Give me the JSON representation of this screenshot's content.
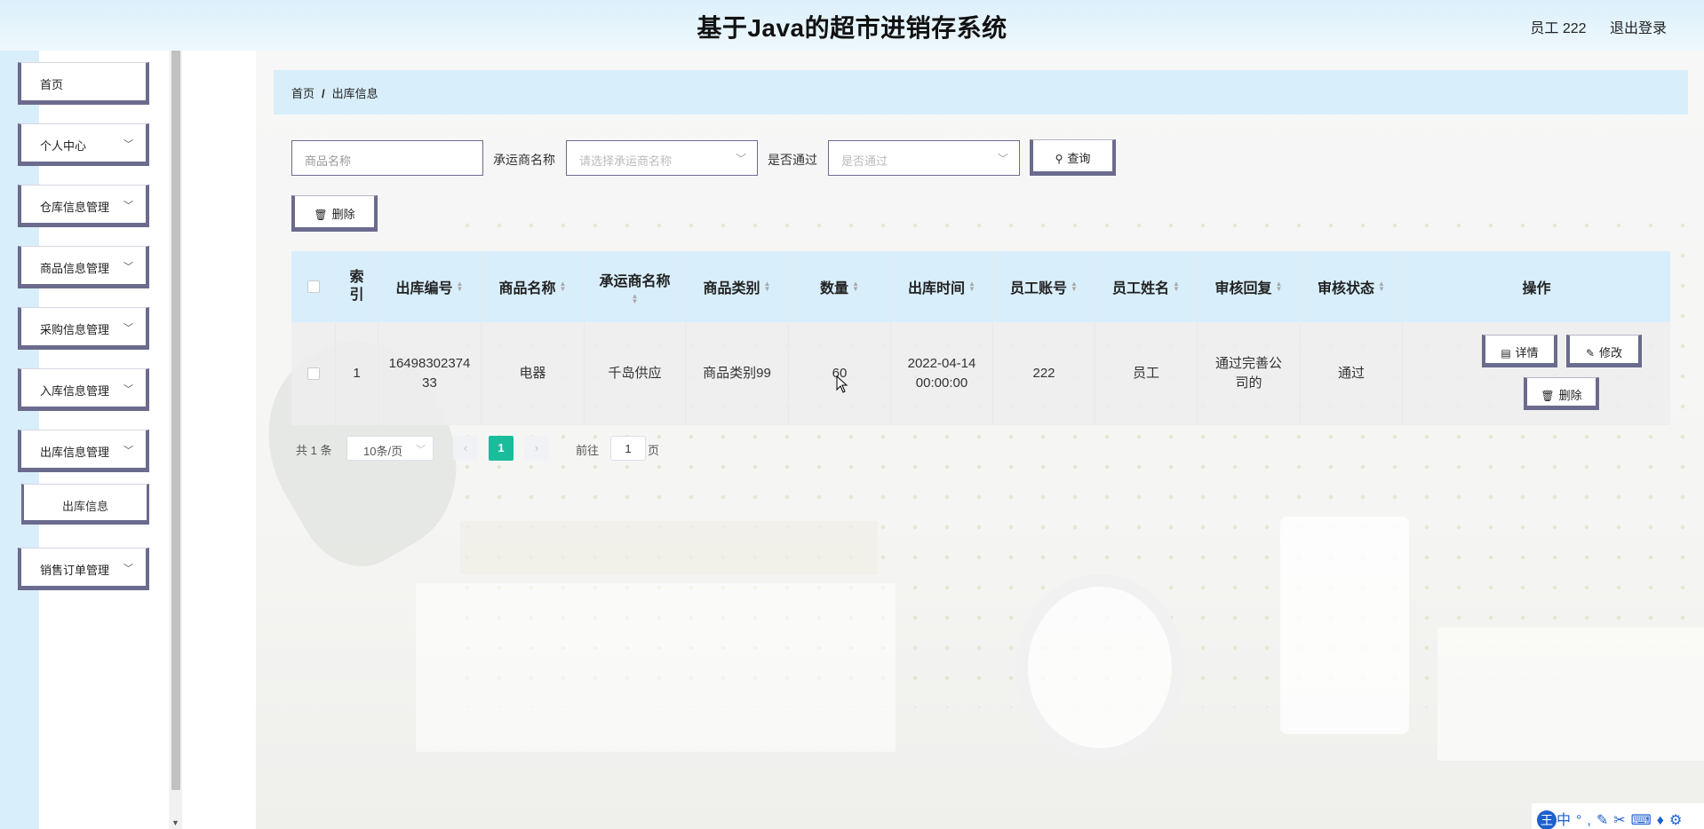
{
  "header": {
    "title": "基于Java的超市进销存系统",
    "user": "员工 222",
    "logout": "退出登录"
  },
  "sidebar": {
    "items": [
      {
        "label": "首页",
        "has_children": false
      },
      {
        "label": "个人中心",
        "has_children": true
      },
      {
        "label": "仓库信息管理",
        "has_children": true
      },
      {
        "label": "商品信息管理",
        "has_children": true
      },
      {
        "label": "采购信息管理",
        "has_children": true
      },
      {
        "label": "入库信息管理",
        "has_children": true
      },
      {
        "label": "出库信息管理",
        "has_children": true
      },
      {
        "label": "出库信息",
        "is_sub": true
      },
      {
        "label": "销售订单管理",
        "has_children": true
      }
    ]
  },
  "breadcrumb": {
    "home": "首页",
    "sep": "/",
    "current": "出库信息"
  },
  "search": {
    "product_placeholder": "商品名称",
    "carrier_label": "承运商名称",
    "carrier_placeholder": "请选择承运商名称",
    "approved_label": "是否通过",
    "approved_placeholder": "是否通过",
    "query_button": "查询"
  },
  "toolbar": {
    "delete_button": "删除"
  },
  "table": {
    "headers": [
      "索引",
      "出库编号",
      "商品名称",
      "承运商名称",
      "商品类别",
      "数量",
      "出库时间",
      "员工账号",
      "员工姓名",
      "审核回复",
      "审核状态",
      "操作"
    ],
    "rows": [
      {
        "index": "1",
        "out_no": "1649830237433",
        "product_name": "电器",
        "carrier": "千岛供应",
        "category": "商品类别99",
        "quantity": "60",
        "out_time": "2022-04-14 00:00:00",
        "emp_account": "222",
        "emp_name": "员工",
        "review_reply": "通过完善公司的",
        "review_status": "通过",
        "actions": {
          "detail": "详情",
          "edit": "修改",
          "delete": "删除"
        }
      }
    ]
  },
  "pagination": {
    "total": "共 1 条",
    "page_size": "10条/页",
    "current_page": "1",
    "goto_label": "前往",
    "goto_value": "1",
    "page_suffix": "页"
  },
  "ime": {
    "logo": "王",
    "lang": "中"
  },
  "colors": {
    "accent_border": "#6b6b8e",
    "light_blue": "#d8eefb",
    "page_active": "#1abc9c"
  }
}
